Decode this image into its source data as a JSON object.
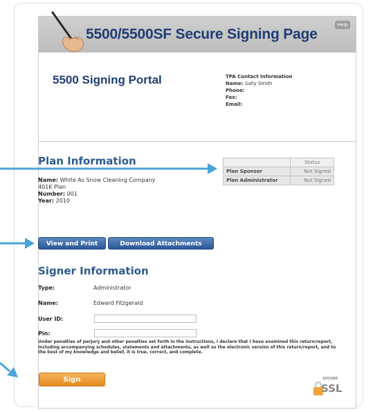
{
  "header": {
    "title": "5500/5500SF Secure Signing Page",
    "help_label": "Help"
  },
  "portal": {
    "title": "5500 Signing Portal",
    "tpa_heading": "TPA Contact Information",
    "tpa_name_label": "Name:",
    "tpa_name_value": "Sally Smith",
    "tpa_phone_label": "Phone:",
    "tpa_fax_label": "Fax:",
    "tpa_email_label": "Email:"
  },
  "plan": {
    "heading": "Plan Information",
    "name_label": "Name:",
    "name_value": "White As Snow Cleaning Company",
    "name_value2": "401K Plan",
    "number_label": "Number:",
    "number_value": "001",
    "year_label": "Year:",
    "year_value": "2010"
  },
  "status_table": {
    "header": "Status",
    "rows": [
      {
        "label": "Plan Sponsor",
        "status": "Not Signed"
      },
      {
        "label": "Plan Administrator",
        "status": "Not Signed"
      }
    ]
  },
  "buttons": {
    "view_print": "View and Print",
    "download": "Download Attachments",
    "sign": "Sign"
  },
  "signer": {
    "heading": "Signer Information",
    "type_label": "Type:",
    "type_value": "Administrator",
    "name_label": "Name:",
    "name_value": "Edward Fitzgerald",
    "userid_label": "User ID:",
    "pin_label": "Pin:"
  },
  "disclaimer": "Under penalties of perjury and other penalties set forth in the instructions, I declare that I have examined this return/report, including accompanying schedules, statements and attachments, as well as the electronic version of this return/report, and to the best of my knowledge and belief, it is true, correct, and complete.",
  "ssl": {
    "secure_label": "SECURE",
    "ssl_label": "SSL"
  },
  "colors": {
    "title_blue": "#1f3c73",
    "section_blue": "#2c5b8f",
    "button_blue": "#2a5796",
    "sign_orange": "#e58a1e",
    "arrow_blue": "#4aa3d8"
  }
}
